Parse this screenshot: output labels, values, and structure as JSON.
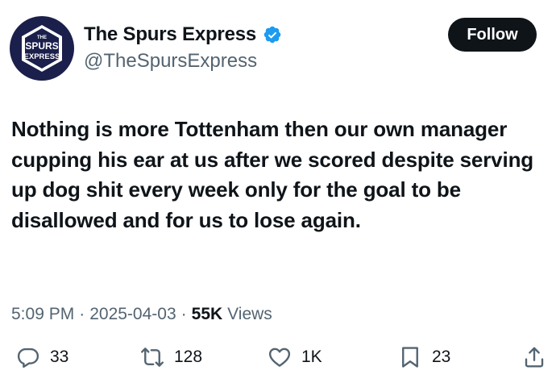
{
  "account": {
    "display_name": "The Spurs Express",
    "handle": "@TheSpursExpress",
    "verified": true,
    "logo_text_top": "THE",
    "logo_text_main1": "SPURS",
    "logo_text_main2": "EXPRESS"
  },
  "follow_button": {
    "label": "Follow"
  },
  "tweet": {
    "text": "Nothing is more Tottenham then our own manager cupping his ear at us after we scored despite serving up dog shit every week only for the goal to be disallowed and for us to lose again.",
    "time": "5:09 PM",
    "date": "2025-04-03",
    "separator": "·",
    "views_count": "55K",
    "views_label": "Views"
  },
  "actions": {
    "reply_count": "33",
    "retweet_count": "128",
    "like_count": "1K",
    "bookmark_count": "23"
  },
  "icons": [
    "verified-icon",
    "reply-icon",
    "retweet-icon",
    "like-icon",
    "bookmark-icon",
    "share-icon"
  ],
  "colors": {
    "text": "#0f1419",
    "secondary": "#536471",
    "verified": "#1d9bf0",
    "follow_bg": "#0f1419",
    "logo_bg": "#1b1f4b"
  }
}
